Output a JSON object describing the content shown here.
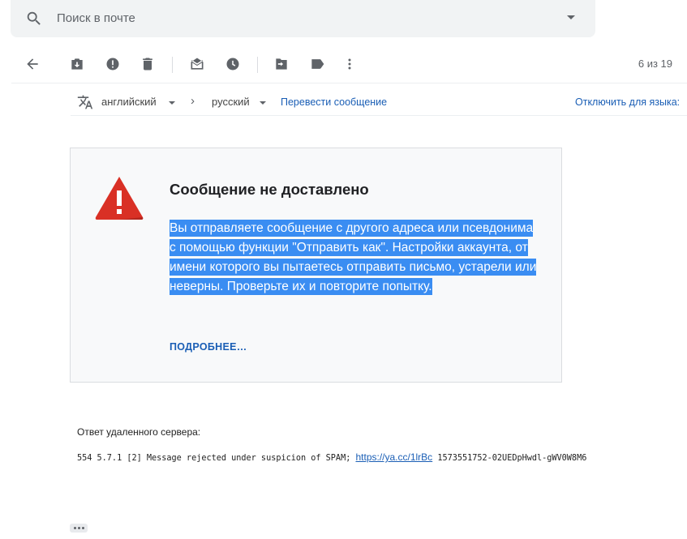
{
  "search": {
    "placeholder": "Поиск в почте",
    "icon": "search-icon"
  },
  "toolbar": {
    "icons": [
      "back-arrow-icon",
      "archive-icon",
      "report-spam-icon",
      "delete-icon",
      "mark-unread-icon",
      "snooze-icon",
      "move-to-icon",
      "label-icon",
      "more-vert-icon"
    ],
    "counter": "6 из 19"
  },
  "translate": {
    "from_lang": "английский",
    "to_lang": "русский",
    "translate_link": "Перевести сообщение",
    "disable_link": "Отключить для языка:"
  },
  "card": {
    "title": "Сообщение не доставлено",
    "body": "Вы отправляете сообщение с другого адреса или псевдонима с помощью функции \"Отправить как\". Настройки аккаунта, от имени которого вы пытаетесь отправить письмо, устарели или неверны. Проверьте их и повторите попытку.",
    "more_link": "ПОДРОБНЕЕ…"
  },
  "server": {
    "label": "Ответ удаленного сервера:",
    "code_prefix": "554 5.7.1 [2] Message rejected under suspicion of SPAM;",
    "link": "https://ya.cc/1lrBc",
    "code_suffix": "1573551752-02UEDpHwdl-gWV0W8M6"
  },
  "colors": {
    "accent": "#1a5eb5",
    "warning": "#d93025",
    "highlight": "#3a8df2"
  }
}
